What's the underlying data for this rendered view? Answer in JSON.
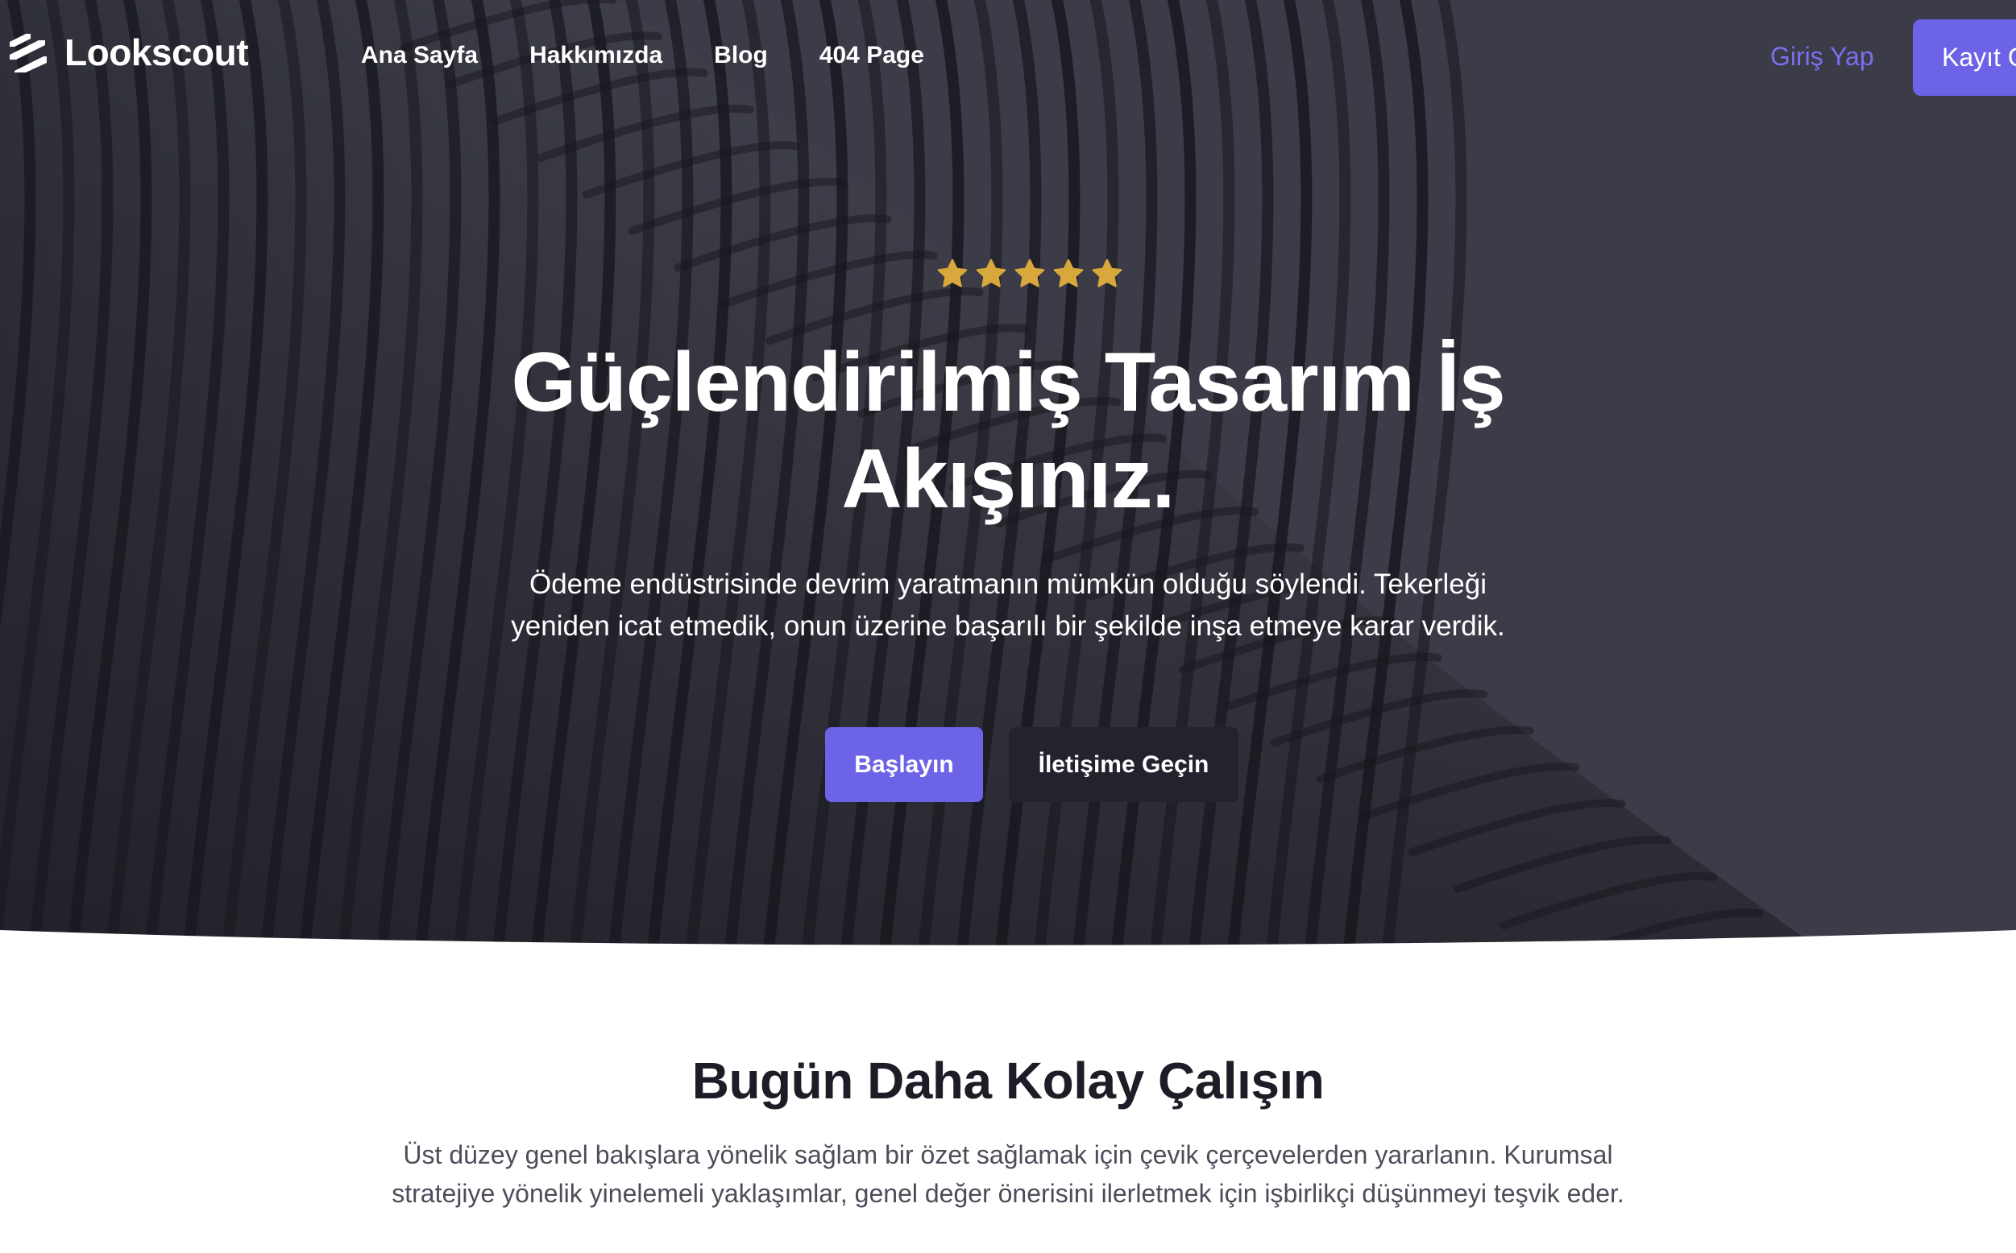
{
  "brand": {
    "name": "Lookscout"
  },
  "nav": {
    "links": [
      "Ana Sayfa",
      "Hakkımızda",
      "Blog",
      "404 Page"
    ],
    "login": "Giriş Yap",
    "signup": "Kayıt Ol"
  },
  "hero": {
    "rating": 5,
    "title_line1": "Güçlendirilmiş Tasarım İş",
    "title_line2": "Akışınız.",
    "subtitle_line1": "Ödeme endüstrisinde devrim yaratmanın mümkün olduğu söylendi. Tekerleği",
    "subtitle_line2": "yeniden icat etmedik, onun üzerine başarılı bir şekilde inşa etmeye karar verdik.",
    "primary_cta": "Başlayın",
    "secondary_cta": "İletişime Geçin"
  },
  "section": {
    "title": "Bugün Daha Kolay Çalışın",
    "text_line1": "Üst düzey genel bakışlara yönelik sağlam bir özet sağlamak için çevik çerçevelerden yararlanın. Kurumsal",
    "text_line2": "stratejiye yönelik yinelemeli yaklaşımlar, genel değer önerisini ilerletmek için işbirlikçi düşünmeyi teşvik eder."
  },
  "colors": {
    "accent": "#6c63e6",
    "hero_background": "#3b3c48",
    "star": "#d9a83c",
    "dark_button": "#23232d"
  },
  "icons": {
    "logo": "stacked-stripes-logo-icon",
    "rating": "star-icon"
  }
}
